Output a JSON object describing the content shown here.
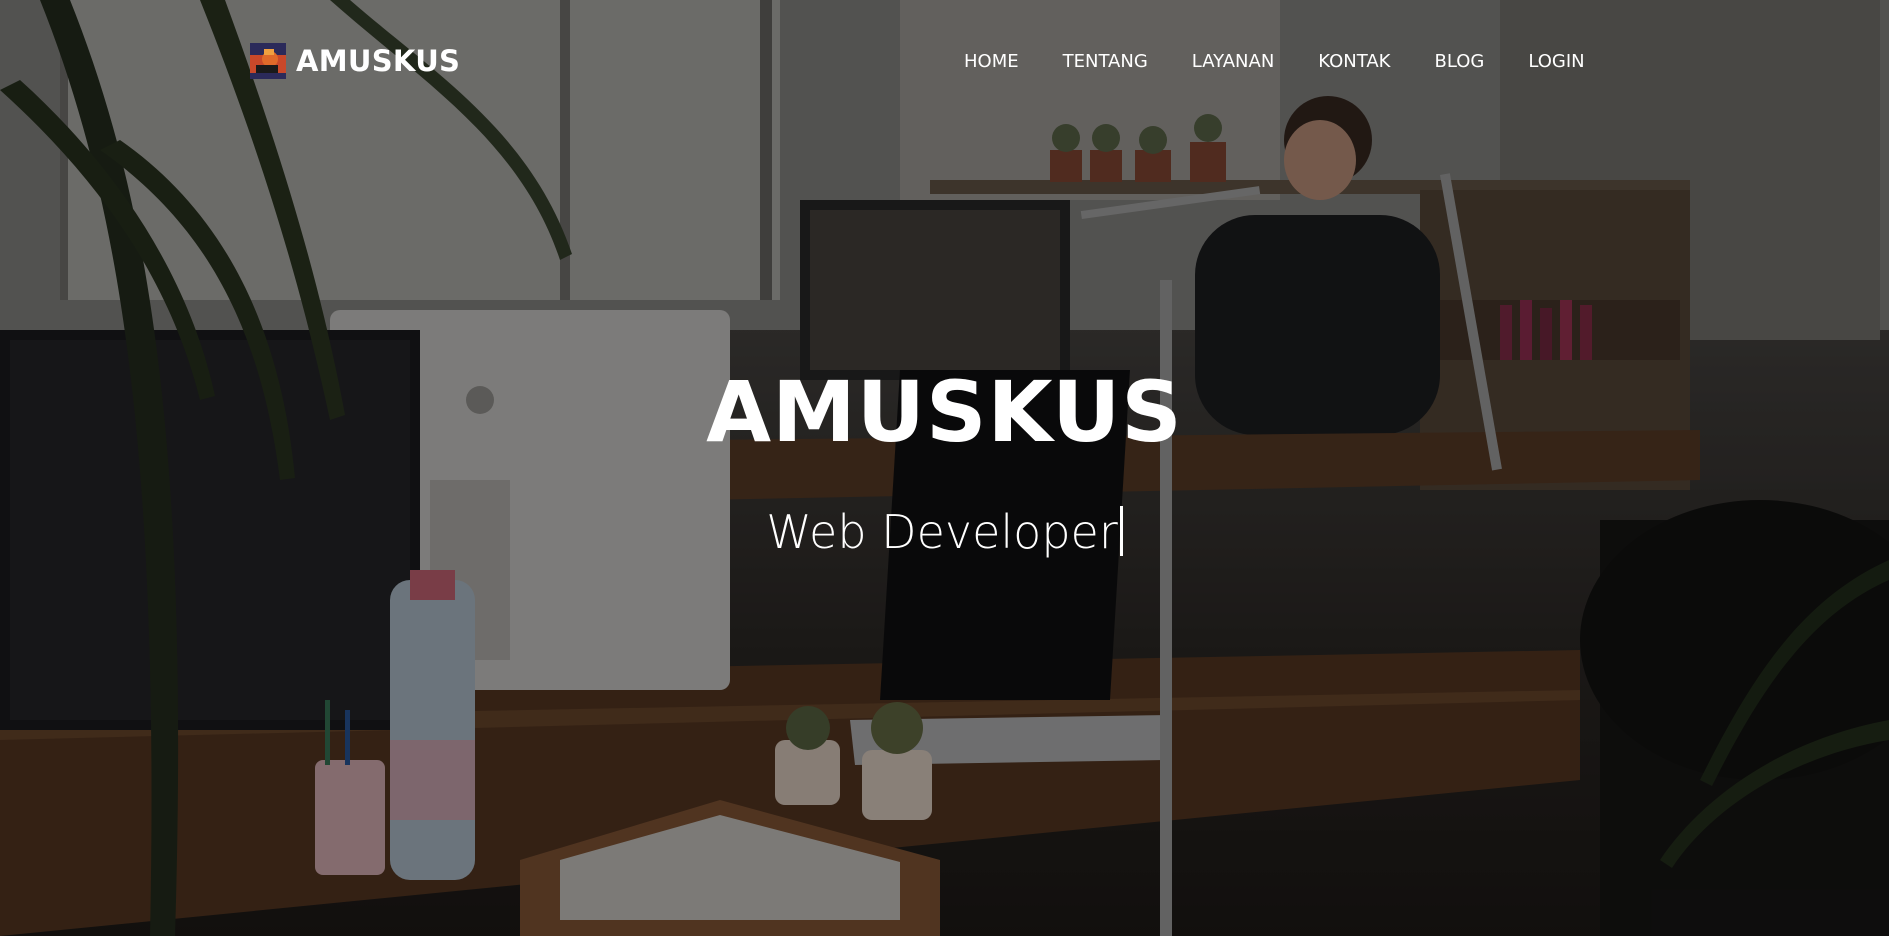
{
  "brand": {
    "name": "AMUSKUS",
    "logo_icon": "brand-logo-icon"
  },
  "nav": {
    "items": [
      {
        "label": "HOME"
      },
      {
        "label": "TENTANG"
      },
      {
        "label": "LAYANAN"
      },
      {
        "label": "KONTAK"
      },
      {
        "label": "BLOG"
      },
      {
        "label": "LOGIN"
      }
    ]
  },
  "hero": {
    "title": "AMUSKUS",
    "subtitle": "Web Developer",
    "background": "office-workspace-photo"
  }
}
